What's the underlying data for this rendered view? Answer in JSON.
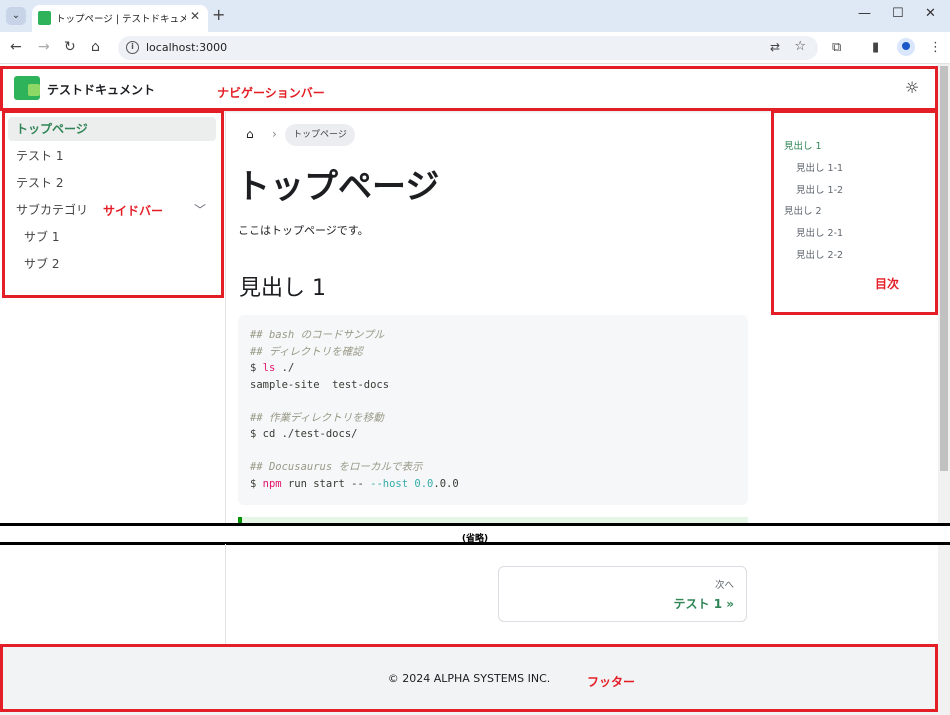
{
  "browser": {
    "tab_title": "トップページ | テストドキュメント",
    "url": "localhost:3000"
  },
  "navbar": {
    "brand": "テストドキュメント"
  },
  "annotations": {
    "navbar": "ナビゲーションバー",
    "sidebar": "サイドバー",
    "toc": "目次",
    "footer": "フッター",
    "omitted": "(省略)"
  },
  "sidebar": {
    "items": [
      {
        "label": "トップページ",
        "active": true
      },
      {
        "label": "テスト 1"
      },
      {
        "label": "テスト 2"
      },
      {
        "label": "サブカテゴリ"
      },
      {
        "label": "サブ 1"
      },
      {
        "label": "サブ 2"
      }
    ]
  },
  "main": {
    "breadcrumb": "トップページ",
    "title": "トップページ",
    "paragraph": "ここはトップページです。",
    "heading1": "見出し 1",
    "code": {
      "lines": [
        "## bash のコードサンプル",
        "## ディレクトリを確認",
        "$ ls ./",
        "sample-site  test-docs",
        "",
        "## 作業ディレクトリを移動",
        "$ cd ./test-docs/",
        "",
        "## Docusaurus をローカルで表示",
        "$ npm run start -- --host 0.0.0.0"
      ]
    }
  },
  "toc": {
    "items": [
      {
        "label": "見出し 1",
        "active": true
      },
      {
        "label": "見出し 1-1"
      },
      {
        "label": "見出し 1-2"
      },
      {
        "label": "見出し 2"
      },
      {
        "label": "見出し 2-1"
      },
      {
        "label": "見出し 2-2"
      }
    ]
  },
  "pager": {
    "sublabel": "次へ",
    "label": "テスト 1 »"
  },
  "footer": {
    "copyright": "© 2024 ALPHA SYSTEMS INC."
  },
  "colors": {
    "primary": "#2e8555",
    "annotation": "#e41e26"
  }
}
